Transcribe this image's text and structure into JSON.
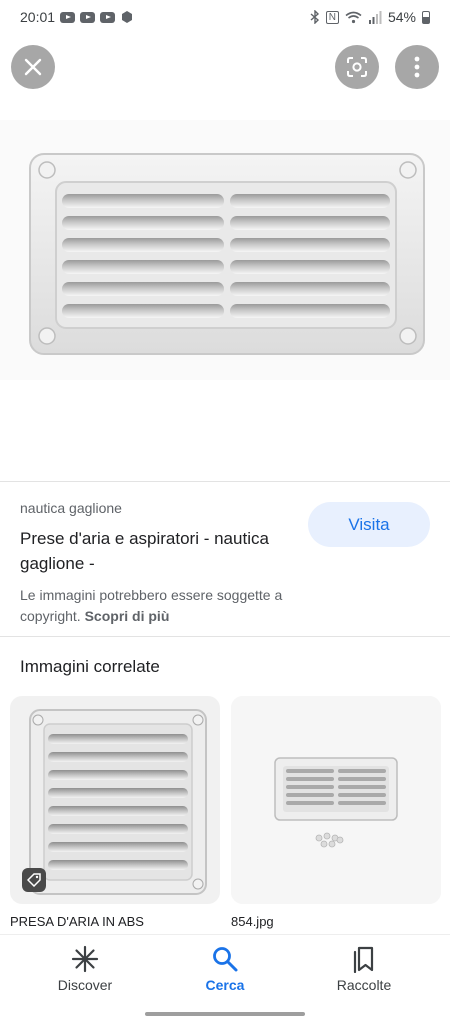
{
  "status_bar": {
    "time": "20:01",
    "battery": "54%",
    "nfc_label": "N"
  },
  "result": {
    "source": "nautica gaglione",
    "title": "Prese d'aria e aspiratori - nautica gaglione -",
    "visit_label": "Visita",
    "copyright_text": "Le immagini potrebbero essere soggette a copyright.",
    "learn_more": "Scopri di più"
  },
  "related": {
    "heading": "Immagini correlate",
    "items": [
      {
        "caption": "PRESA D'ARIA IN ABS"
      },
      {
        "caption": "854.jpg"
      }
    ]
  },
  "nav": {
    "items": [
      {
        "label": "Discover",
        "icon": "asterisk-icon"
      },
      {
        "label": "Cerca",
        "icon": "search-icon"
      },
      {
        "label": "Raccolte",
        "icon": "collections-icon"
      }
    ],
    "active": "Cerca",
    "active_color": "#1a73e8"
  },
  "colors": {
    "accent": "#1a73e8",
    "visit_bg": "#e8f0fe",
    "floating_button": "#a7a7a7"
  }
}
